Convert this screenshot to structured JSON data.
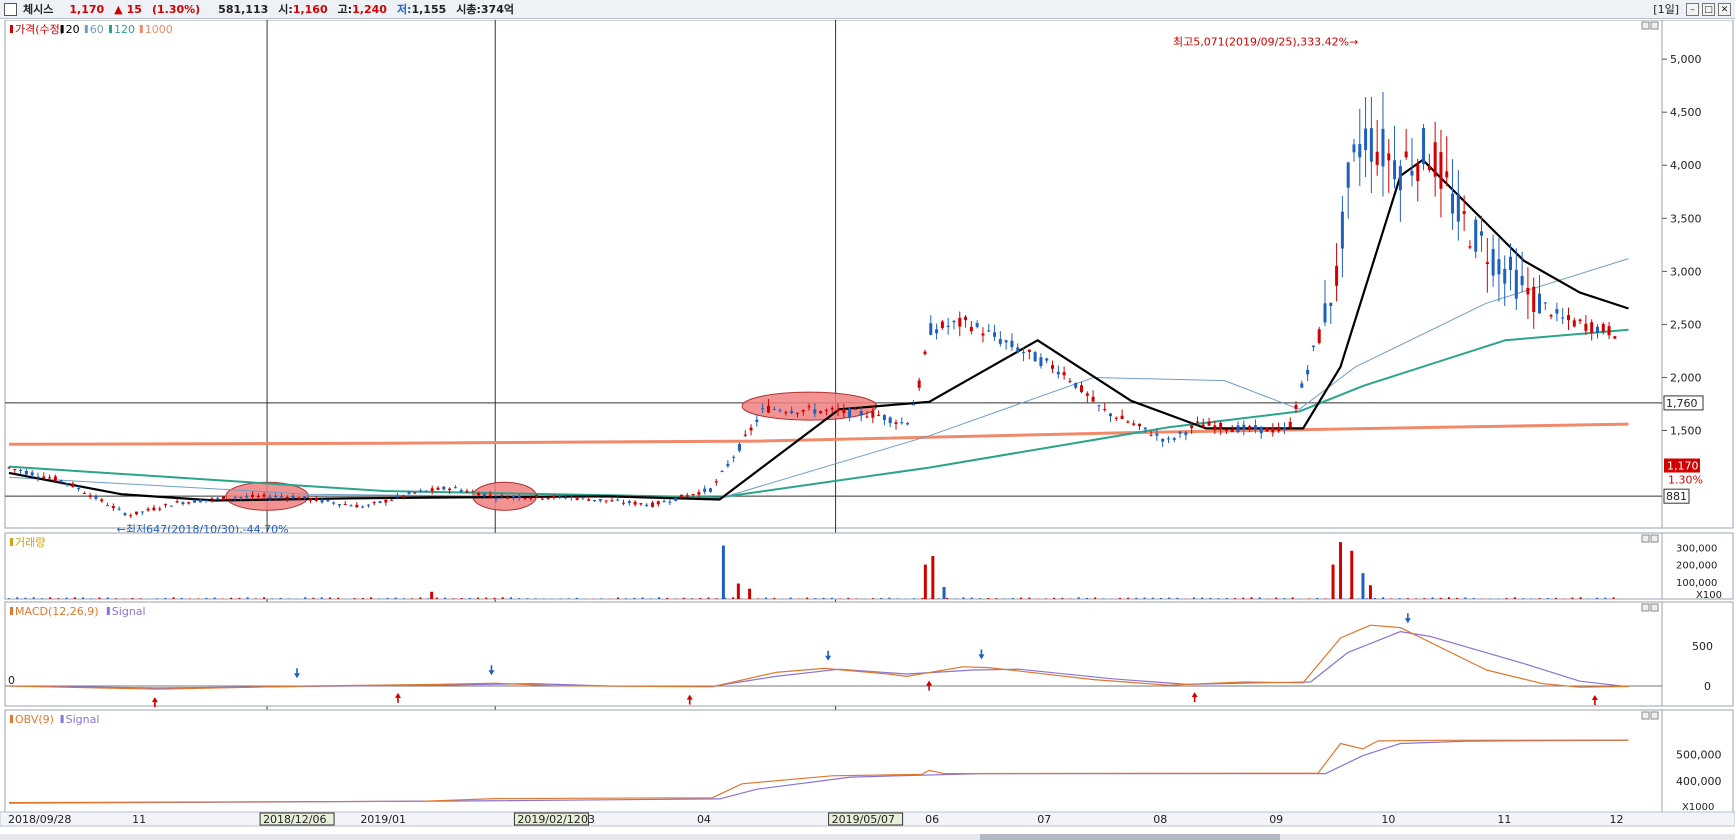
{
  "header": {
    "stock_name": "체시스",
    "price": "1,170",
    "change_arrow": "▲",
    "change": "15",
    "change_pct": "(1.30%)",
    "volume": "581,113",
    "open_label": "시:",
    "open": "1,160",
    "high_label": "고:",
    "high": "1,240",
    "low_label": "저:",
    "low": "1,155",
    "marketcap_label": "시총:",
    "marketcap": "374억",
    "period": "[1일]"
  },
  "colors": {
    "up": "#d40000",
    "down": "#1f5fbf",
    "ma20": "#000000",
    "ma60": "#6f9ec9",
    "ma120": "#2aa58a",
    "ma1000": "#f08a6a",
    "macd": "#e0772d",
    "signal": "#8a73d6",
    "ellipse": "#f08080"
  },
  "chart_data": [
    {
      "type": "candlestick",
      "title": "",
      "legend": [
        {
          "label": "가격(수정)",
          "color": "#d40000"
        },
        {
          "label": "20",
          "color": "#000000"
        },
        {
          "label": "60",
          "color": "#6f9ec9"
        },
        {
          "label": "120",
          "color": "#2aa58a"
        },
        {
          "label": "1000",
          "color": "#f08a6a"
        }
      ],
      "x_range": [
        "2018/09/28",
        "2019/12/06"
      ],
      "ylim": [
        600,
        5350
      ],
      "y_ticks": [
        1500,
        2000,
        2500,
        3000,
        3500,
        4000,
        4500,
        5000
      ],
      "y_tick_labels": [
        "1,500",
        "2,000",
        "2,500",
        "3,000",
        "3,500",
        "4,000",
        "4,500",
        "5,000"
      ],
      "date_labels": [
        {
          "label": "2018/09/28",
          "day": 0,
          "boxed": false
        },
        {
          "label": "11",
          "day": 34,
          "boxed": false
        },
        {
          "label": "2018/12/06",
          "day": 69,
          "boxed": true
        },
        {
          "label": "2019/01",
          "day": 95,
          "boxed": false
        },
        {
          "label": "2019/02/12",
          "day": 137,
          "boxed": true
        },
        {
          "label": "03",
          "day": 154,
          "boxed": false
        },
        {
          "label": "04",
          "day": 185,
          "boxed": false
        },
        {
          "label": "2019/05/07",
          "day": 221,
          "boxed": true
        },
        {
          "label": "06",
          "day": 246,
          "boxed": false
        },
        {
          "label": "07",
          "day": 276,
          "boxed": false
        },
        {
          "label": "08",
          "day": 307,
          "boxed": false
        },
        {
          "label": "09",
          "day": 338,
          "boxed": false
        },
        {
          "label": "10",
          "day": 368,
          "boxed": false
        },
        {
          "label": "11",
          "day": 399,
          "boxed": false
        },
        {
          "label": "12",
          "day": 429,
          "boxed": false
        }
      ],
      "vertical_markers_day": [
        69,
        130,
        221
      ],
      "horizontal_lines": [
        {
          "value": 1760,
          "label": "1,760"
        },
        {
          "value": 881,
          "label": "881"
        }
      ],
      "current_price": {
        "label": "1,170",
        "pct": "1.30%"
      },
      "annotations": [
        {
          "text": "최고5,071(2019/09/25),333.42%",
          "day": 362,
          "value": 5071
        },
        {
          "text": "최저647(2018/10/30),-44.70%",
          "day": 32,
          "value": 647
        }
      ],
      "highlight_ellipses": [
        {
          "day_from": 58,
          "day_to": 80,
          "center_value": 880
        },
        {
          "day_from": 124,
          "day_to": 141,
          "center_value": 880
        },
        {
          "day_from": 196,
          "day_to": 232,
          "center_value": 1730
        }
      ],
      "price_anchors": [
        {
          "day": 0,
          "close": 1150
        },
        {
          "day": 15,
          "close": 1020
        },
        {
          "day": 32,
          "close": 700
        },
        {
          "day": 45,
          "close": 820
        },
        {
          "day": 60,
          "close": 870
        },
        {
          "day": 75,
          "close": 880
        },
        {
          "day": 95,
          "close": 780
        },
        {
          "day": 108,
          "close": 910
        },
        {
          "day": 118,
          "close": 960
        },
        {
          "day": 130,
          "close": 880
        },
        {
          "day": 150,
          "close": 870
        },
        {
          "day": 172,
          "close": 800
        },
        {
          "day": 188,
          "close": 950
        },
        {
          "day": 196,
          "close": 1380
        },
        {
          "day": 202,
          "close": 1710
        },
        {
          "day": 220,
          "close": 1680
        },
        {
          "day": 232,
          "close": 1650
        },
        {
          "day": 240,
          "close": 1560
        },
        {
          "day": 244,
          "close": 2000
        },
        {
          "day": 246,
          "close": 2450
        },
        {
          "day": 256,
          "close": 2520
        },
        {
          "day": 268,
          "close": 2300
        },
        {
          "day": 282,
          "close": 2050
        },
        {
          "day": 292,
          "close": 1700
        },
        {
          "day": 310,
          "close": 1400
        },
        {
          "day": 318,
          "close": 1560
        },
        {
          "day": 328,
          "close": 1520
        },
        {
          "day": 342,
          "close": 1500
        },
        {
          "day": 355,
          "close": 2950
        },
        {
          "day": 358,
          "close": 3800
        },
        {
          "day": 362,
          "close": 4300
        },
        {
          "day": 372,
          "close": 4000
        },
        {
          "day": 380,
          "close": 4150
        },
        {
          "day": 388,
          "close": 3500
        },
        {
          "day": 398,
          "close": 3100
        },
        {
          "day": 406,
          "close": 2800
        },
        {
          "day": 415,
          "close": 2550
        },
        {
          "day": 430,
          "close": 2420
        }
      ],
      "ma_series": [
        {
          "name": "20",
          "points": [
            [
              0,
              1100
            ],
            [
              30,
              900
            ],
            [
              55,
              840
            ],
            [
              90,
              860
            ],
            [
              120,
              870
            ],
            [
              160,
              880
            ],
            [
              190,
              850
            ],
            [
              222,
              1700
            ],
            [
              246,
              1770
            ],
            [
              275,
              2350
            ],
            [
              300,
              1780
            ],
            [
              320,
              1520
            ],
            [
              346,
              1520
            ],
            [
              356,
              2100
            ],
            [
              372,
              3900
            ],
            [
              378,
              4050
            ],
            [
              405,
              3100
            ],
            [
              420,
              2800
            ],
            [
              433,
              2650
            ]
          ]
        },
        {
          "name": "60",
          "points": [
            [
              0,
              1060
            ],
            [
              80,
              900
            ],
            [
              190,
              860
            ],
            [
              246,
              1450
            ],
            [
              290,
              2000
            ],
            [
              325,
              1970
            ],
            [
              345,
              1700
            ],
            [
              360,
              2100
            ],
            [
              395,
              2700
            ],
            [
              433,
              3120
            ]
          ]
        },
        {
          "name": "120",
          "points": [
            [
              0,
              1160
            ],
            [
              100,
              930
            ],
            [
              190,
              870
            ],
            [
              246,
              1150
            ],
            [
              310,
              1530
            ],
            [
              345,
              1680
            ],
            [
              362,
              1920
            ],
            [
              400,
              2350
            ],
            [
              433,
              2450
            ]
          ]
        },
        {
          "name": "1000",
          "points": [
            [
              0,
              1370
            ],
            [
              100,
              1380
            ],
            [
              200,
              1400
            ],
            [
              300,
              1480
            ],
            [
              433,
              1560
            ]
          ]
        }
      ]
    },
    {
      "type": "bar",
      "title": "",
      "legend": [
        {
          "label": "거래량",
          "color": "#d4a017"
        }
      ],
      "y_tick_labels": [
        "300,000",
        "200,000",
        "100,000",
        "X100"
      ],
      "spikes": [
        {
          "day": 113,
          "value": 42000,
          "dir": "up"
        },
        {
          "day": 191,
          "value": 310000,
          "dir": "down"
        },
        {
          "day": 195,
          "value": 90000,
          "dir": "up"
        },
        {
          "day": 198,
          "value": 60000,
          "dir": "up"
        },
        {
          "day": 245,
          "value": 200000,
          "dir": "up"
        },
        {
          "day": 247,
          "value": 250000,
          "dir": "up"
        },
        {
          "day": 250,
          "value": 70000,
          "dir": "down"
        },
        {
          "day": 354,
          "value": 200000,
          "dir": "up"
        },
        {
          "day": 356,
          "value": 330000,
          "dir": "up"
        },
        {
          "day": 359,
          "value": 280000,
          "dir": "up"
        },
        {
          "day": 362,
          "value": 150000,
          "dir": "down"
        },
        {
          "day": 364,
          "value": 80000,
          "dir": "up"
        }
      ]
    },
    {
      "type": "line",
      "title": "",
      "legend": [
        {
          "label": "MACD(12,26,9)",
          "color": "#e0772d"
        },
        {
          "label": "Signal",
          "color": "#8a73d6"
        }
      ],
      "ylim": [
        -200,
        1000
      ],
      "y_tick_labels": [
        "500",
        "0"
      ],
      "zero_label": "0",
      "series": [
        {
          "name": "MACD(12,26,9)",
          "points": [
            [
              0,
              0
            ],
            [
              40,
              -40
            ],
            [
              80,
              0
            ],
            [
              115,
              20
            ],
            [
              130,
              35
            ],
            [
              145,
              5
            ],
            [
              188,
              -10
            ],
            [
              205,
              170
            ],
            [
              218,
              220
            ],
            [
              235,
              150
            ],
            [
              240,
              120
            ],
            [
              255,
              240
            ],
            [
              262,
              230
            ],
            [
              290,
              80
            ],
            [
              310,
              10
            ],
            [
              330,
              50
            ],
            [
              346,
              40
            ],
            [
              356,
              600
            ],
            [
              364,
              760
            ],
            [
              372,
              730
            ],
            [
              395,
              200
            ],
            [
              410,
              30
            ],
            [
              420,
              -15
            ],
            [
              433,
              -5
            ]
          ]
        },
        {
          "name": "Signal",
          "points": [
            [
              0,
              0
            ],
            [
              40,
              -25
            ],
            [
              80,
              -5
            ],
            [
              120,
              15
            ],
            [
              140,
              30
            ],
            [
              160,
              0
            ],
            [
              188,
              -5
            ],
            [
              205,
              120
            ],
            [
              222,
              210
            ],
            [
              240,
              150
            ],
            [
              258,
              200
            ],
            [
              270,
              210
            ],
            [
              295,
              90
            ],
            [
              315,
              20
            ],
            [
              335,
              40
            ],
            [
              348,
              50
            ],
            [
              358,
              420
            ],
            [
              372,
              680
            ],
            [
              380,
              620
            ],
            [
              405,
              280
            ],
            [
              420,
              60
            ],
            [
              433,
              -10
            ]
          ]
        }
      ],
      "up_arrows_day": [
        39,
        104,
        182,
        246,
        317,
        424
      ],
      "down_arrows_day": [
        77,
        129,
        219,
        260,
        374
      ]
    },
    {
      "type": "line",
      "title": "",
      "legend": [
        {
          "label": "OBV(9)",
          "color": "#e0772d"
        },
        {
          "label": "Signal",
          "color": "#8a73d6"
        }
      ],
      "ylim": [
        300000,
        650000
      ],
      "y_tick_labels": [
        "500,000",
        "400,000",
        "X1000"
      ],
      "series": [
        {
          "name": "OBV(9)",
          "points": [
            [
              0,
              320000
            ],
            [
              110,
              325000
            ],
            [
              130,
              335000
            ],
            [
              188,
              338000
            ],
            [
              196,
              390000
            ],
            [
              220,
              420000
            ],
            [
              244,
              425000
            ],
            [
              246,
              440000
            ],
            [
              250,
              428000
            ],
            [
              350,
              430000
            ],
            [
              356,
              540000
            ],
            [
              362,
              520000
            ],
            [
              366,
              550000
            ],
            [
              380,
              552000
            ],
            [
              433,
              553000
            ]
          ]
        },
        {
          "name": "Signal",
          "points": [
            [
              0,
              318000
            ],
            [
              120,
              326000
            ],
            [
              190,
              334000
            ],
            [
              200,
              370000
            ],
            [
              225,
              415000
            ],
            [
              260,
              428000
            ],
            [
              352,
              428000
            ],
            [
              362,
              495000
            ],
            [
              372,
              540000
            ],
            [
              390,
              549000
            ],
            [
              433,
              552000
            ]
          ]
        }
      ]
    }
  ]
}
